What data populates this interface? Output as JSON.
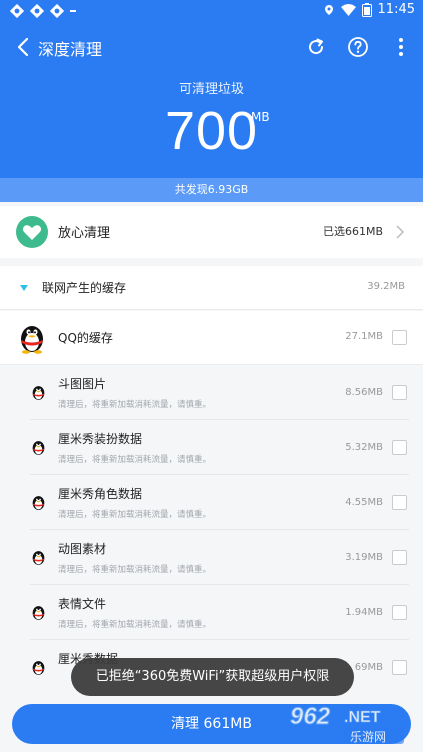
{
  "status_bar": {
    "time": "11:45",
    "badge": ""
  },
  "header": {
    "title": "深度清理",
    "junk_label": "可清理垃圾",
    "junk_size": "700",
    "junk_unit": "MB",
    "found_text": "共发现6.93GB"
  },
  "safe_clean": {
    "title": "放心清理",
    "value": "已选661MB"
  },
  "section": {
    "title": "联网产生的缓存",
    "size": "39.2MB"
  },
  "qq_cache": {
    "title": "QQ的缓存",
    "size": "27.1MB"
  },
  "sub_items": [
    {
      "title": "斗图图片",
      "desc": "清理后，将重新加载消耗流量，请慎重。",
      "size": "8.56MB"
    },
    {
      "title": "厘米秀装扮数据",
      "desc": "清理后，将重新加载消耗流量，请慎重。",
      "size": "5.32MB"
    },
    {
      "title": "厘米秀角色数据",
      "desc": "清理后，将重新加载消耗流量，请慎重。",
      "size": "4.55MB"
    },
    {
      "title": "动图素材",
      "desc": "清理后，将重新加载消耗流量，请慎重。",
      "size": "3.19MB"
    },
    {
      "title": "表情文件",
      "desc": "清理后，将重新加载消耗流量，请慎重。",
      "size": "1.94MB"
    },
    {
      "title": "厘米秀数据",
      "desc": "",
      "size": "69MB"
    }
  ],
  "toast": "已拒绝“360免费WiFi”获取超级用户权限",
  "clean_button": "清理 661MB",
  "colors": {
    "primary": "#2b7bf2",
    "accent_green": "#3dbb8f",
    "section_triangle": "#2fc1e6"
  },
  "watermark": {
    "logo_text": "962.NET",
    "site_text": "乐游网"
  }
}
